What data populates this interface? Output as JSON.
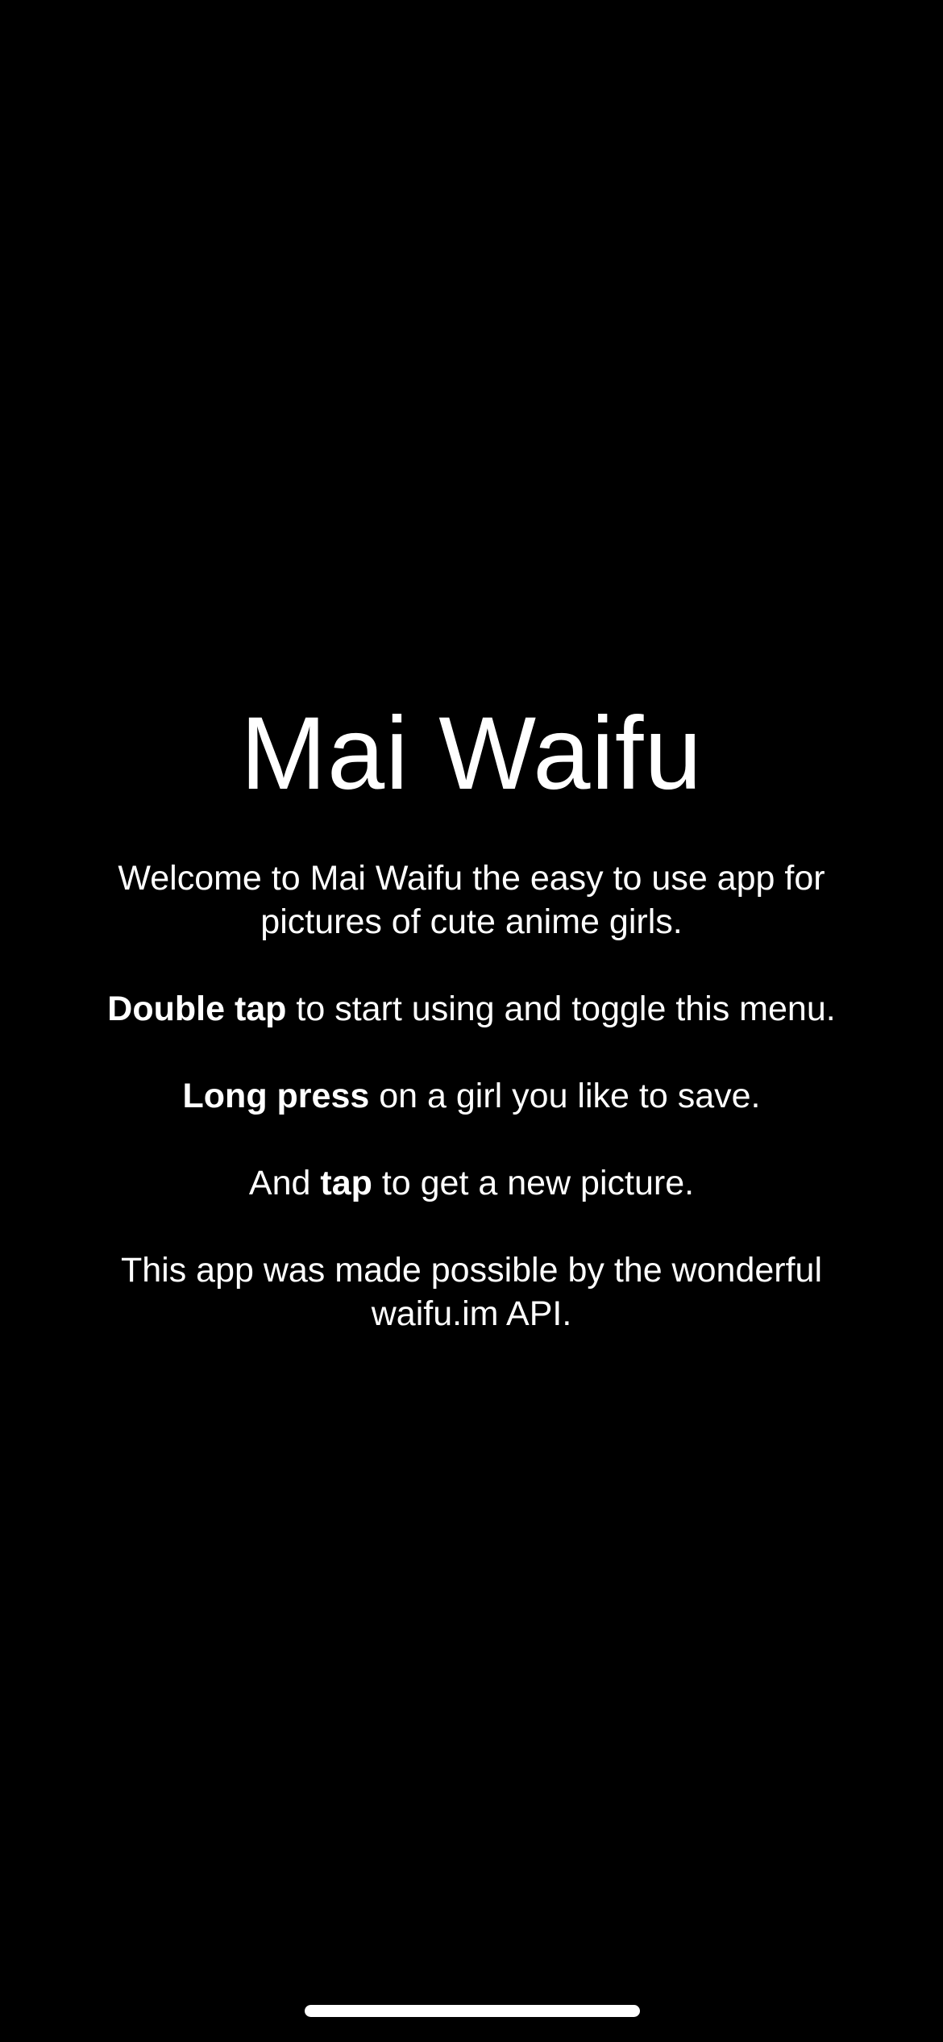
{
  "app": {
    "title": "Mai Waifu"
  },
  "welcome": {
    "intro_line1": "Welcome to Mai Waifu the easy to use app for",
    "intro_line2": "pictures of cute anime girls.",
    "double_tap_bold": "Double tap",
    "double_tap_rest": " to start using and toggle this menu.",
    "long_press_bold": "Long press",
    "long_press_rest": " on a girl you like to save.",
    "tap_prefix": "And ",
    "tap_bold": "tap",
    "tap_rest": " to get a new picture.",
    "credit_line1": "This app was made possible by the wonderful",
    "credit_line2": "waifu.im API."
  },
  "colors": {
    "background": "#000000",
    "text": "#ffffff",
    "home_indicator": "#ffffff"
  }
}
